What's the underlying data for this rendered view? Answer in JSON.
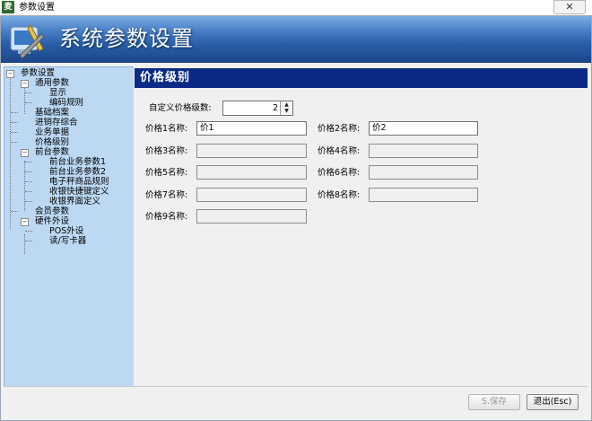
{
  "window": {
    "title": "参数设置",
    "app_icon": "麦",
    "close_glyph": "✕"
  },
  "banner": {
    "title": "系统参数设置"
  },
  "tree": {
    "root": "参数设置",
    "general": "通用参数",
    "display": "显示",
    "coding_rules": "编码规则",
    "basic_archive": "基础档案",
    "inventory": "进销存综合",
    "business_docs": "业务单据",
    "price_level": "价格级别",
    "frontend": "前台参数",
    "fe_business1": "前台业务参数1",
    "fe_business2": "前台业务参数2",
    "scale_rules": "电子秤商品规则",
    "cashier_shortcut": "收银快捷键定义",
    "cashier_ui": "收银界面定义",
    "member": "会员参数",
    "hardware": "硬件外设",
    "pos_device": "POS外设",
    "card_reader": "读/写卡器"
  },
  "main": {
    "header": "价格级别",
    "custom_levels_label": "自定义价格级数:",
    "custom_levels_value": "2",
    "fields": [
      {
        "label": "价格1名称:",
        "value": "价1",
        "enabled": true
      },
      {
        "label": "价格2名称:",
        "value": "价2",
        "enabled": true
      },
      {
        "label": "价格3名称:",
        "value": "",
        "enabled": false
      },
      {
        "label": "价格4名称:",
        "value": "",
        "enabled": false
      },
      {
        "label": "价格5名称:",
        "value": "",
        "enabled": false
      },
      {
        "label": "价格6名称:",
        "value": "",
        "enabled": false
      },
      {
        "label": "价格7名称:",
        "value": "",
        "enabled": false
      },
      {
        "label": "价格8名称:",
        "value": "",
        "enabled": false
      },
      {
        "label": "价格9名称:",
        "value": "",
        "enabled": false
      }
    ]
  },
  "buttons": {
    "save": "S.保存",
    "exit": "退出(Esc)"
  },
  "colors": {
    "header_bg": "#0a2a85",
    "tree_bg": "#bcd8f3"
  }
}
